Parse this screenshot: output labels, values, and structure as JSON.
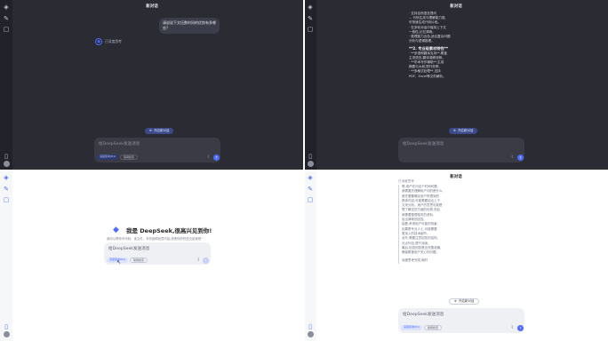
{
  "app": {
    "conversation_title": "新对话"
  },
  "sidebar": {
    "logo_icon": "deepseek-whale-icon",
    "new_chat_icon": "new-chat-icon",
    "chat_icon": "chat-bubble-icon",
    "phone_icon": "mobile-phone-icon",
    "avatar_icon": "user-avatar"
  },
  "q1": {
    "user_message": "请说说下文伍数时间的优势有多哪些?",
    "ai_label": "已深度思考",
    "new_conv_label": "开启新对话",
    "input_placeholder": "给DeepSeek发送消息",
    "chip_deep": "深度思考(R1)",
    "chip_search": "联网搜索"
  },
  "q2": {
    "lines": [
      "· 支持自然语言提问",
      "... 代码生成与理解能力强,",
      "可快速生成代码片段。",
      "· 在多轮对话中保持上下文",
      "一致性,记忆清晰。",
      "· 推理能力出色,适合复杂问题",
      "分析与逻辑推理。"
    ],
    "section_title": "**2. 专业级素材特性**",
    "section_lines": [
      "· **多语种翻译支持**,覆盖",
      "主流语言,翻译准确流畅。",
      "· **学术写作辅助**,生成",
      "摘要与大纲,提升效率。",
      "· **多格式处理**,支持",
      "PDF、Excel等文件解析。"
    ],
    "new_conv_label": "开启新对话",
    "input_placeholder": "给DeepSeek发送消息"
  },
  "q3": {
    "welcome_title": "我是 DeepSeek,很高兴见到你!",
    "welcome_sub": "我可以帮你写代码、读文件、写作各种创意内容,请把你的任务交给我吧~",
    "input_placeholder": "给DeepSeek发送消息",
    "chip_deep": "深度思考(R1)",
    "chip_search": "联网搜索"
  },
  "q4": {
    "ai_label": "已深度思考",
    "lines": [
      "嗯,用户在问这个时间问题,",
      "我需要先理解用户问的是什么,",
      "首先需要确定用户所提到的",
      "具体内容,可能需要结合上下",
      "文来分析。用户的意思可能是",
      "想了解这些方面的优势,然后",
      "我需要整理相关的资料,",
      "给出清晰的回答。",
      "接着,考虑用户可能的背景,",
      "如果是专业人士,可能需要",
      "更深入的技术细节。",
      "另外,需要注意回答的结构,",
      "分点列出,便于阅读。",
      "最后,检查回答是否完整准确,",
      "确保覆盖用户关心的问题。"
    ],
    "footer_note": "深度思考完成,耗时",
    "new_conv_label": "开启新对话",
    "input_placeholder": "给DeepSeek发送消息",
    "chip_deep": "深度思考(R1)",
    "chip_search": "联网搜索"
  },
  "colors": {
    "accent": "#4d6bfe",
    "dark_bg": "#2a2b33",
    "light_bg": "#ffffff"
  }
}
